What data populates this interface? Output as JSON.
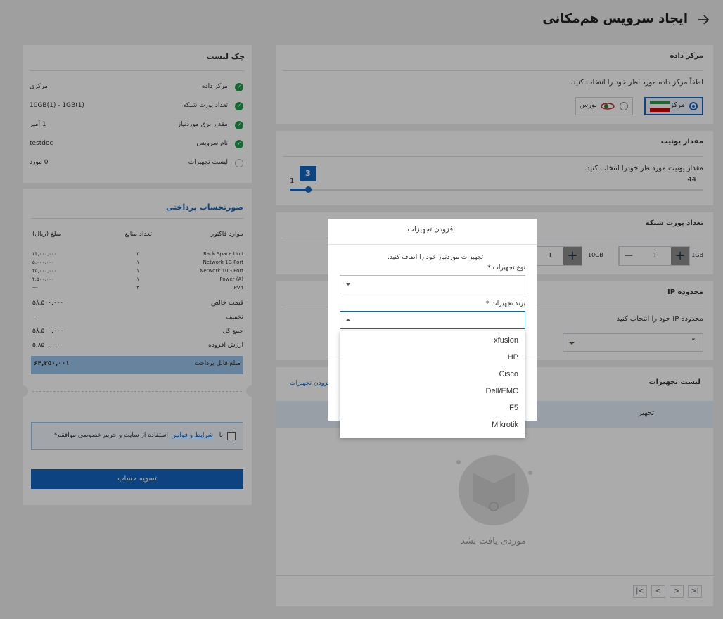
{
  "page": {
    "title": "ایجاد سرویس هم‌مکانی",
    "back_icon": "arrow-right"
  },
  "datacenter": {
    "title": "مرکز داده",
    "hint": "لطفاً مرکز داده مورد نظر خود را انتخاب کنید.",
    "options": [
      {
        "label": "مرکزی",
        "selected": true
      },
      {
        "label": "بورس",
        "selected": false
      }
    ]
  },
  "unit": {
    "title": "مقدار یونیت",
    "hint": "مقدار یونیت موردنظر خودرا انتخاب کنید.",
    "value_badge": "3",
    "min": "1",
    "max": "44"
  },
  "ports": {
    "title": "تعداد پورت شبکه",
    "port_1g": {
      "label": "1GB",
      "value": "1"
    },
    "port_10g": {
      "label": "10GB",
      "value": "1"
    }
  },
  "ip": {
    "title": "محدوده IP",
    "hint": "محدوده IP خود را انتخاب کنید",
    "value": "۴"
  },
  "equipment": {
    "title": "لیست تجهیزات",
    "add_link": "افزودن تجهیزات",
    "col_header": "تجهیز",
    "empty": "موردی یافت نشد"
  },
  "pagination": [
    "|<",
    "<",
    ">",
    ">|"
  ],
  "checklist": {
    "title": "چک لیست",
    "items": [
      {
        "label": "مرکز داده",
        "value": "مرکزی",
        "done": true
      },
      {
        "label": "تعداد پورت شبکه",
        "value": "10GB(1) - 1GB(1)",
        "done": true
      },
      {
        "label": "مقدار برق موردنیاز",
        "value": "1 آمپر",
        "done": true
      },
      {
        "label": "نام سرویس",
        "value": "testdoc",
        "done": true
      },
      {
        "label": "لیست تجهیزات",
        "value": "0 مورد",
        "done": false
      }
    ]
  },
  "invoice": {
    "title": "صورتحساب پرداختی",
    "headers": {
      "item": "موارد فاکتور",
      "count": "تعداد منابع",
      "amount": "مبلغ (ریال)"
    },
    "rows": [
      {
        "item": "Rack Space Unit",
        "count": "۳",
        "amount": "۲۴,۰۰۰,۰۰۰"
      },
      {
        "item": "Network 1G Port",
        "count": "۱",
        "amount": "۵,۰۰۰,۰۰۰"
      },
      {
        "item": "Network 10G Port",
        "count": "۱",
        "amount": "۲۵,۰۰۰,۰۰۰"
      },
      {
        "item": "Power (A)",
        "count": "۱",
        "amount": "۴,۵۰۰,۰۰۰"
      },
      {
        "item": "IPV4",
        "count": "۴",
        "amount": "---"
      }
    ],
    "totals": [
      {
        "label": "قیمت خالص",
        "value": "۵۸,۵۰۰,۰۰۰"
      },
      {
        "label": "تخفیف",
        "value": "۰"
      },
      {
        "label": "جمع کل",
        "value": "۵۸,۵۰۰,۰۰۰"
      },
      {
        "label": "ارزش افزوده",
        "value": "۵,۸۵۰,۰۰۰"
      }
    ],
    "payable": {
      "label": "مبلغ قابل پرداخت",
      "value": "۶۴,۳۵۰,۰۰۱"
    },
    "terms_prefix": "با",
    "terms_link": "شرایط و قوانین",
    "terms_suffix": "استفاده از سایت و حریم خصوصی موافقم*",
    "pay_button": "تسویه حساب"
  },
  "modal": {
    "title": "افزودن تجهیزات",
    "hint": "تجهیزات موردنیاز خود را اضافه کنید.",
    "type_label": "نوع تجهیزات *",
    "brand_label": "برند تجهیزات *",
    "brand_options": [
      "xfusion",
      "HP",
      "Cisco",
      "Dell/EMC",
      "F5",
      "Mikrotik"
    ]
  },
  "colors": {
    "accent": "#1565c0",
    "success": "#1f9d4c",
    "payable_bg": "#9cc3ea"
  }
}
